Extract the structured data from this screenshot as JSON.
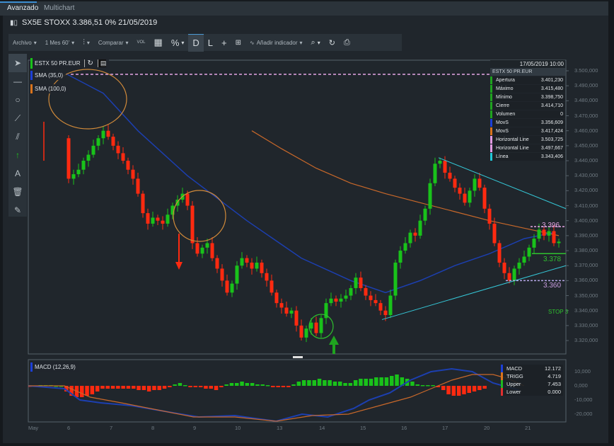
{
  "tabs": [
    {
      "label": "Avanzado",
      "active": true
    },
    {
      "label": "Multichart",
      "active": false
    }
  ],
  "title": "SX5E STOXX 3.386,51 0% 21/05/2019",
  "toolbar": {
    "archivo": "Archivo",
    "period": "1 Mes 60'",
    "comparar": "Comparar",
    "vol": "VOL",
    "percent": "%",
    "d": "D",
    "l": "L",
    "add_indicator": "Añadir indicador"
  },
  "legend": {
    "symbol": "ESTX 50 PR.EUR",
    "sma35": "SMA (35,0)",
    "sma100": "SMA (100,0)",
    "macd": "MACD (12,26,9)"
  },
  "info_box": {
    "date": "17/05/2019 10:00",
    "symbol": "ESTX 50 PR.EUR",
    "rows": [
      {
        "label": "Apertura",
        "value": "3.401,230",
        "color": "#1fa31f"
      },
      {
        "label": "Máximo",
        "value": "3.415,480",
        "color": "#1fa31f"
      },
      {
        "label": "Mínimo",
        "value": "3.398,750",
        "color": "#1fa31f"
      },
      {
        "label": "Cierre",
        "value": "3.414,710",
        "color": "#1fa31f"
      },
      {
        "label": "Volumen",
        "value": "0",
        "color": "#1fa31f"
      },
      {
        "label": "MovS",
        "value": "3.356,609",
        "color": "#1c3fd6"
      },
      {
        "label": "MovS",
        "value": "3.417,424",
        "color": "#d9731c"
      },
      {
        "label": "Horizontal Line",
        "value": "3.503,725",
        "color": "#e39be3"
      },
      {
        "label": "Horizontal Line",
        "value": "3.497,667",
        "color": "#e39be3"
      },
      {
        "label": "Línea",
        "value": "3.343,406",
        "color": "#22c8d8"
      }
    ]
  },
  "macd_info": [
    {
      "label": "MACD",
      "value": "12.172",
      "color": "#1c3fd6"
    },
    {
      "label": "TRIGG",
      "value": "4.719",
      "color": "#d9731c"
    },
    {
      "label": "Upper",
      "value": "7.453",
      "color": "#1fb81f"
    },
    {
      "label": "Lower",
      "value": "0.000",
      "color": "#e03030"
    }
  ],
  "annotations": {
    "level_396": "3.396",
    "level_378": "3.378",
    "level_360": "3.360",
    "stop": "STOP 3"
  },
  "price_axis": [
    "3.500,000",
    "3.490,000",
    "3.480,000",
    "3.470,000",
    "3.460,000",
    "3.450,000",
    "3.440,000",
    "3.430,000",
    "3.420,000",
    "3.410,000",
    "3.400,000",
    "3.390,000",
    "3.380,000",
    "3.370,000",
    "3.360,000",
    "3.350,000",
    "3.340,000",
    "3.330,000",
    "3.320,000"
  ],
  "macd_axis": [
    "10,000",
    "0,000",
    "-10,000",
    "-20,000"
  ],
  "date_axis": [
    "May",
    "6",
    "7",
    "8",
    "9",
    "10",
    "13",
    "14",
    "15",
    "16",
    "17",
    "20",
    "21"
  ],
  "colors": {
    "up": "#19c21a",
    "down": "#ff2a10",
    "sma35": "#1c3fb0",
    "sma100": "#c8682a",
    "trend": "#35c6d6",
    "hline": "#e6a6e6"
  },
  "chart_data": {
    "type": "candlestick",
    "first_candle": {
      "o": 3462,
      "h": 3466,
      "l": 3440,
      "c": 3442
    },
    "open_start": 3455,
    "closes": [
      3428,
      3431,
      3434,
      3440,
      3444,
      3450,
      3455,
      3460,
      3456,
      3450,
      3445,
      3440,
      3434,
      3428,
      3418,
      3405,
      3398,
      3402,
      3400,
      3398,
      3404,
      3410,
      3414,
      3418,
      3410,
      3385,
      3378,
      3382,
      3385,
      3375,
      3368,
      3360,
      3352,
      3358,
      3370,
      3375,
      3372,
      3368,
      3372,
      3365,
      3360,
      3352,
      3345,
      3342,
      3338,
      3340,
      3330,
      3322,
      3328,
      3332,
      3325,
      3335,
      3345,
      3348,
      3346,
      3348,
      3350,
      3355,
      3362,
      3355,
      3350,
      3347,
      3345,
      3340,
      3337,
      3350,
      3372,
      3380,
      3385,
      3392,
      3390,
      3400,
      3408,
      3425,
      3438,
      3440,
      3432,
      3428,
      3422,
      3418,
      3412,
      3420,
      3428,
      3422,
      3408,
      3398,
      3385,
      3372,
      3365,
      3360,
      3368,
      3372,
      3376,
      3382,
      3388,
      3394,
      3390,
      3393,
      3385,
      3386
    ],
    "sma35": [
      [
        0.5,
        3498
      ],
      [
        8,
        3485
      ],
      [
        15,
        3460
      ],
      [
        25,
        3430
      ],
      [
        37,
        3400
      ],
      [
        48,
        3375
      ],
      [
        58,
        3360
      ],
      [
        65,
        3352
      ],
      [
        72,
        3360
      ],
      [
        79,
        3370
      ],
      [
        86,
        3378
      ],
      [
        93,
        3388
      ],
      [
        99,
        3392
      ]
    ],
    "sma100": [
      [
        38,
        3460
      ],
      [
        44,
        3448
      ],
      [
        51,
        3435
      ],
      [
        58,
        3425
      ],
      [
        65,
        3418
      ],
      [
        72,
        3412
      ],
      [
        79,
        3406
      ],
      [
        86,
        3400
      ],
      [
        93,
        3395
      ],
      [
        100,
        3390
      ]
    ],
    "macd_hist": [
      -0.5,
      -0.5,
      0.5,
      0.5,
      0.5,
      0,
      0,
      -4,
      -7,
      -8,
      -8,
      -7,
      -6,
      -4,
      -2,
      -2,
      -2,
      -2,
      -2,
      -2,
      -2,
      -3,
      -3,
      -4,
      -3,
      -3,
      -2,
      -1,
      1,
      2,
      0.5,
      -1,
      -1,
      -1,
      -2,
      -2,
      -3,
      -1,
      1,
      2,
      2,
      3,
      2,
      2,
      1,
      1,
      0.5,
      -1,
      -1,
      -1,
      -1,
      1,
      3,
      4,
      4,
      4,
      5,
      4,
      4,
      3,
      3,
      2,
      2,
      4,
      5,
      5,
      5,
      6,
      6,
      6,
      7,
      8,
      6,
      5,
      3,
      1,
      0.5,
      0.5,
      0.5,
      -1,
      -3,
      -6,
      -7,
      -7,
      -6,
      -5,
      -4,
      -3,
      -2
    ],
    "macd_line": [
      [
        0,
        0
      ],
      [
        7,
        -2
      ],
      [
        10,
        -10
      ],
      [
        14,
        -12
      ],
      [
        20,
        -14
      ],
      [
        28,
        -19
      ],
      [
        33,
        -22
      ],
      [
        40,
        -21
      ],
      [
        48,
        -25
      ],
      [
        53,
        -20
      ],
      [
        58,
        -22
      ],
      [
        63,
        -16
      ],
      [
        66,
        -10
      ],
      [
        70,
        -5
      ],
      [
        74,
        4
      ],
      [
        78,
        10
      ],
      [
        82,
        12
      ],
      [
        86,
        10
      ],
      [
        90,
        2
      ],
      [
        95,
        -3
      ]
    ],
    "signal_line": [
      [
        0,
        0
      ],
      [
        7,
        0
      ],
      [
        12,
        -8
      ],
      [
        18,
        -12
      ],
      [
        25,
        -17
      ],
      [
        32,
        -22
      ],
      [
        40,
        -22
      ],
      [
        48,
        -25
      ],
      [
        55,
        -21
      ],
      [
        62,
        -20
      ],
      [
        68,
        -14
      ],
      [
        74,
        -8
      ],
      [
        78,
        -2
      ],
      [
        82,
        4
      ],
      [
        86,
        8
      ],
      [
        90,
        8
      ],
      [
        93,
        5
      ],
      [
        96,
        0
      ]
    ],
    "ylim": [
      3315,
      3503
    ],
    "macd_ylim": [
      -25,
      15
    ]
  }
}
